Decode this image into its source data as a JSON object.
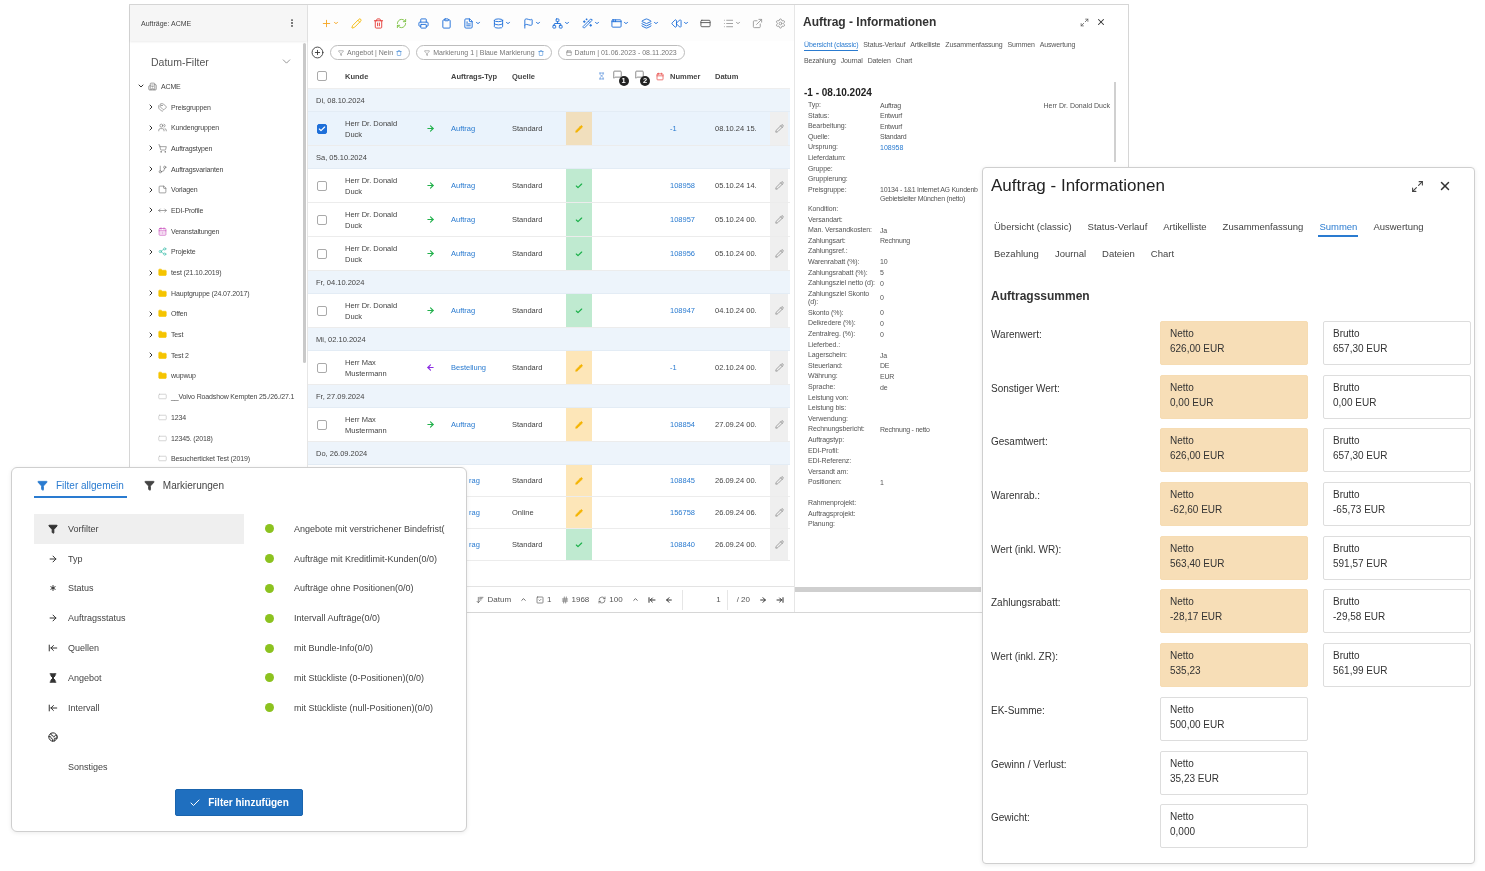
{
  "main_window": {
    "sidebar": {
      "title": "Aufträge: ACME",
      "date_filter": "Datum-Filter",
      "tree": [
        {
          "label": "ACME",
          "kind": "building",
          "expandable": true,
          "expanded": true,
          "children": [
            {
              "label": "Preisgruppen",
              "kind": "tag",
              "expandable": true,
              "expanded": false
            },
            {
              "label": "Kundengruppen",
              "kind": "users",
              "expandable": true,
              "expanded": false
            },
            {
              "label": "Auftragstypen",
              "kind": "cart",
              "expandable": true,
              "expanded": false
            },
            {
              "label": "Auftragsvarianten",
              "kind": "branch",
              "expandable": true,
              "expanded": false
            },
            {
              "label": "Vorlagen",
              "kind": "note",
              "expandable": true,
              "expanded": false
            },
            {
              "label": "EDI-Profile",
              "kind": "arrows",
              "expandable": true,
              "expanded": false
            },
            {
              "label": "Veranstaltungen",
              "kind": "event",
              "expandable": true,
              "expanded": false
            },
            {
              "label": "Projekte",
              "kind": "project",
              "expandable": true,
              "expanded": false
            },
            {
              "label": "test (21.10.2019)",
              "kind": "folder",
              "expandable": true,
              "expanded": false
            },
            {
              "label": "Hauptgruppe (24.07.2017)",
              "kind": "folder",
              "expandable": true,
              "expanded": false
            },
            {
              "label": "Offen",
              "kind": "folder",
              "expandable": true,
              "expanded": false
            },
            {
              "label": "Test",
              "kind": "folder",
              "expandable": true,
              "expanded": false
            },
            {
              "label": "Test 2",
              "kind": "folder",
              "expandable": true,
              "expanded": false
            },
            {
              "label": "wupwup",
              "kind": "folder",
              "expandable": false
            },
            {
              "label": "__Volvo Roadshow Kempten 25./26./27.1",
              "kind": "ticket",
              "expandable": false
            },
            {
              "label": "1234",
              "kind": "ticket",
              "expandable": false
            },
            {
              "label": "12345. (2018)",
              "kind": "ticket",
              "expandable": false
            },
            {
              "label": "Besucherticket Test (2019)",
              "kind": "ticket",
              "expandable": false
            }
          ]
        }
      ]
    },
    "filter_chips": [
      {
        "label": "Angebot | Nein",
        "kind": "filter"
      },
      {
        "label": "Markierung 1 | Blaue Markierung",
        "kind": "filter"
      },
      {
        "label": "Datum | 01.06.2023 - 08.11.2023",
        "kind": "date"
      }
    ],
    "table": {
      "header": {
        "select_all_checked": false,
        "kunde": "Kunde",
        "typ": "Auftrags-Typ",
        "quelle": "Quelle",
        "badges": [
          "1",
          "2"
        ],
        "nummer": "Nummer",
        "datum": "Datum"
      },
      "rows": [
        {
          "kind": "group",
          "label": "Di, 08.10.2024"
        },
        {
          "kind": "order",
          "checked": true,
          "kunde": "Herr Dr. Donald Duck",
          "incoming": false,
          "typ": "Auftrag",
          "quelle": "Standard",
          "done": false,
          "nummer": "-1",
          "datum": "08.10.24 15."
        },
        {
          "kind": "group",
          "label": "Sa, 05.10.2024"
        },
        {
          "kind": "order",
          "checked": false,
          "kunde": "Herr Dr. Donald Duck",
          "incoming": false,
          "typ": "Auftrag",
          "quelle": "Standard",
          "done": true,
          "nummer": "108958",
          "datum": "05.10.24 14."
        },
        {
          "kind": "order",
          "checked": false,
          "kunde": "Herr Dr. Donald Duck",
          "incoming": false,
          "typ": "Auftrag",
          "quelle": "Standard",
          "done": true,
          "nummer": "108957",
          "datum": "05.10.24 00."
        },
        {
          "kind": "order",
          "checked": false,
          "kunde": "Herr Dr. Donald Duck",
          "incoming": false,
          "typ": "Auftrag",
          "quelle": "Standard",
          "done": true,
          "nummer": "108956",
          "datum": "05.10.24 00."
        },
        {
          "kind": "group",
          "label": "Fr, 04.10.2024"
        },
        {
          "kind": "order",
          "checked": false,
          "kunde": "Herr Dr. Donald Duck",
          "incoming": false,
          "typ": "Auftrag",
          "quelle": "Standard",
          "done": true,
          "nummer": "108947",
          "datum": "04.10.24 00."
        },
        {
          "kind": "group",
          "label": "Mi, 02.10.2024"
        },
        {
          "kind": "order",
          "checked": false,
          "kunde": "Herr Max Mustermann",
          "incoming": true,
          "typ": "Bestellung",
          "quelle": "Standard",
          "done": false,
          "nummer": "-1",
          "datum": "02.10.24 00."
        },
        {
          "kind": "group",
          "label": "Fr, 27.09.2024"
        },
        {
          "kind": "order",
          "checked": false,
          "kunde": "Herr Max Mustermann",
          "incoming": false,
          "typ": "Auftrag",
          "quelle": "Standard",
          "done": false,
          "nummer": "108854",
          "datum": "27.09.24 00."
        },
        {
          "kind": "group",
          "label": "Do, 26.09.2024"
        },
        {
          "kind": "partial",
          "typ": "rag",
          "quelle": "Standard",
          "done": false,
          "nummer": "108845",
          "datum": "26.09.24 00."
        },
        {
          "kind": "partial",
          "typ": "rag",
          "quelle": "Online",
          "done": false,
          "nummer": "156758",
          "datum": "26.09.24 06."
        },
        {
          "kind": "partial",
          "typ": "rag",
          "quelle": "Standard",
          "done": true,
          "nummer": "108840",
          "datum": "26.09.24 00."
        }
      ]
    },
    "footer": {
      "sort_field": "Datum",
      "selected_count": "1",
      "total": "1968",
      "page_size": "100",
      "page": "1",
      "page_count": "/ 20"
    },
    "info_panel": {
      "title": "Auftrag - Informationen",
      "tab_rows": [
        [
          {
            "label": "Übersicht (classic)",
            "selected": true
          },
          {
            "label": "Status-Verlauf",
            "selected": false
          },
          {
            "label": "Artikelliste",
            "selected": false
          },
          {
            "label": "Zusammenfassung",
            "selected": false
          },
          {
            "label": "Summen",
            "selected": false
          },
          {
            "label": "Auswertung",
            "selected": false
          }
        ],
        [
          {
            "label": "Bezahlung",
            "selected": false
          },
          {
            "label": "Journal",
            "selected": false
          },
          {
            "label": "Dateien",
            "selected": false
          },
          {
            "label": "Chart",
            "selected": false
          }
        ]
      ],
      "heading": "-1 - 08.10.2024",
      "customer": "Herr Dr. Donald Duck",
      "fields": [
        {
          "label": "Typ:",
          "value": "Auftrag"
        },
        {
          "label": "Status:",
          "value": "Entwurf"
        },
        {
          "label": "Bearbeitung:",
          "value": "Entwurf"
        },
        {
          "label": "Quelle:",
          "value": "Standard"
        },
        {
          "label": "Ursprung:",
          "value": "108958",
          "kind": "link"
        },
        {
          "label": "Lieferdatum:"
        },
        {
          "label": "Gruppe:"
        },
        {
          "label": "Gruppierung:"
        },
        {
          "label": "Preisgruppe:",
          "lines": [
            "10134 - 1&1 Internet AG Kundenb",
            "Gebietsleiter München (netto)"
          ]
        },
        {
          "label": "Kondition:"
        },
        {
          "label": "Versandart:"
        },
        {
          "label": "Man. Versandkosten:",
          "value": "Ja"
        },
        {
          "label": "Zahlungsart:",
          "value": "Rechnung"
        },
        {
          "label": "Zahlungsref.:"
        },
        {
          "label": "Warenrabatt (%):",
          "value": "10"
        },
        {
          "label": "Zahlungsrabatt (%):",
          "value": "5"
        },
        {
          "label": "Zahlungsziel netto (d):",
          "value": "0"
        },
        {
          "label": "Zahlungsziel Skonto (d):",
          "value": "0"
        },
        {
          "label": "Skonto (%):",
          "value": "0"
        },
        {
          "label": "Delkredere (%):",
          "value": "0"
        },
        {
          "label": "Zentralreg. (%):",
          "value": "0"
        },
        {
          "label": "Lieferbed.:"
        },
        {
          "label": "Lagerschein:",
          "value": "Ja"
        },
        {
          "label": "Steuerland:",
          "value": "DE"
        },
        {
          "label": "Währung:",
          "value": "EUR"
        },
        {
          "label": "Sprache:",
          "value": "de"
        },
        {
          "label": "Leistung von:"
        },
        {
          "label": "Leistung bis:"
        },
        {
          "label": "Verwendung:"
        },
        {
          "label": "Rechnungsbericht:",
          "value": "Rechnung - netto"
        },
        {
          "label": "Auftragstyp:"
        },
        {
          "label": "EDI-Profil:"
        },
        {
          "label": "EDI-Referenz:"
        },
        {
          "label": "Versandt am:"
        },
        {
          "label": "Positionen:",
          "value": "1"
        }
      ],
      "project_fields": [
        {
          "label": "Rahmenprojekt:"
        },
        {
          "label": "Auftragsprojekt:"
        },
        {
          "label": "Planung:"
        }
      ]
    }
  },
  "summary_panel": {
    "title": "Auftrag - Informationen",
    "tab_rows": [
      [
        {
          "label": "Übersicht (classic)",
          "selected": false
        },
        {
          "label": "Status-Verlauf",
          "selected": false
        },
        {
          "label": "Artikelliste",
          "selected": false
        },
        {
          "label": "Zusammenfassung",
          "selected": false
        },
        {
          "label": "Summen",
          "selected": true
        },
        {
          "label": "Auswertung",
          "selected": false
        }
      ],
      [
        {
          "label": "Bezahlung",
          "selected": false
        },
        {
          "label": "Journal",
          "selected": false
        },
        {
          "label": "Dateien",
          "selected": false
        },
        {
          "label": "Chart",
          "selected": false
        }
      ]
    ],
    "heading": "Auftragssummen",
    "rows": [
      {
        "label": "Warenwert:",
        "netto": {
          "label": "Netto",
          "value": "626,00 EUR",
          "highlighted": true
        },
        "brutto": {
          "label": "Brutto",
          "value": "657,30 EUR"
        }
      },
      {
        "label": "Sonstiger Wert:",
        "netto": {
          "label": "Netto",
          "value": "0,00 EUR",
          "highlighted": true
        },
        "brutto": {
          "label": "Brutto",
          "value": "0,00 EUR"
        }
      },
      {
        "label": "Gesamtwert:",
        "netto": {
          "label": "Netto",
          "value": "626,00 EUR",
          "highlighted": true
        },
        "brutto": {
          "label": "Brutto",
          "value": "657,30 EUR"
        }
      },
      {
        "label": "Warenrab.:",
        "netto": {
          "label": "Netto",
          "value": "-62,60 EUR",
          "highlighted": true
        },
        "brutto": {
          "label": "Brutto",
          "value": "-65,73 EUR"
        }
      },
      {
        "label": "Wert (inkl. WR):",
        "netto": {
          "label": "Netto",
          "value": "563,40 EUR",
          "highlighted": true
        },
        "brutto": {
          "label": "Brutto",
          "value": "591,57 EUR"
        }
      },
      {
        "label": "Zahlungsrabatt:",
        "netto": {
          "label": "Netto",
          "value": "-28,17 EUR",
          "highlighted": true
        },
        "brutto": {
          "label": "Brutto",
          "value": "-29,58 EUR"
        }
      },
      {
        "label": "Wert (inkl. ZR):",
        "netto": {
          "label": "Netto",
          "value": "535,23",
          "highlighted": true
        },
        "brutto": {
          "label": "Brutto",
          "value": "561,99 EUR"
        }
      },
      {
        "label": "EK-Summe:",
        "netto": {
          "label": "Netto",
          "value": "500,00 EUR",
          "highlighted": false
        }
      },
      {
        "label": "Gewinn / Verlust:",
        "netto": {
          "label": "Netto",
          "value": "35,23 EUR",
          "highlighted": false
        }
      },
      {
        "label": "Gewicht:",
        "netto": {
          "label": "Netto",
          "value": "0,000",
          "highlighted": false
        }
      }
    ]
  },
  "filter_popup": {
    "tabs": [
      {
        "label": "Filter allgemein",
        "selected": true
      },
      {
        "label": "Markierungen",
        "selected": false
      }
    ],
    "categories": [
      {
        "label": "Vorfilter",
        "kind": "filter",
        "selected": true
      },
      {
        "label": "Typ",
        "kind": "arrow",
        "selected": false
      },
      {
        "label": "Status",
        "kind": "asterisk",
        "selected": false
      },
      {
        "label": "Auftragsstatus",
        "kind": "arrow",
        "selected": false
      },
      {
        "label": "Quellen",
        "kind": "arrow-bar",
        "selected": false
      },
      {
        "label": "Angebot",
        "kind": "hourglass",
        "selected": false
      },
      {
        "label": "Intervall",
        "kind": "arrow-bar",
        "selected": false
      },
      {
        "kind": "globe",
        "selected": false
      },
      {
        "label": "Sonstiges",
        "kind": "plain",
        "selected": false
      }
    ],
    "options": [
      {
        "label": "Angebote mit verstrichener Bindefrist(",
        "color": "#8cc21f"
      },
      {
        "label": "Aufträge mit Kreditlimit-Kunden(0/0)",
        "color": "#8cc21f"
      },
      {
        "label": "Aufträge ohne Positionen(0/0)",
        "color": "#8cc21f"
      },
      {
        "label": "Intervall Aufträge(0/0)",
        "color": "#8cc21f"
      },
      {
        "label": "mit Bundle-Info(0/0)",
        "color": "#8cc21f"
      },
      {
        "label": "mit Stückliste (0-Positionen)(0/0)",
        "color": "#8cc21f"
      },
      {
        "label": "mit Stückliste (null-Positionen)(0/0)",
        "color": "#8cc21f"
      }
    ],
    "button": "Filter hinzufügen"
  }
}
